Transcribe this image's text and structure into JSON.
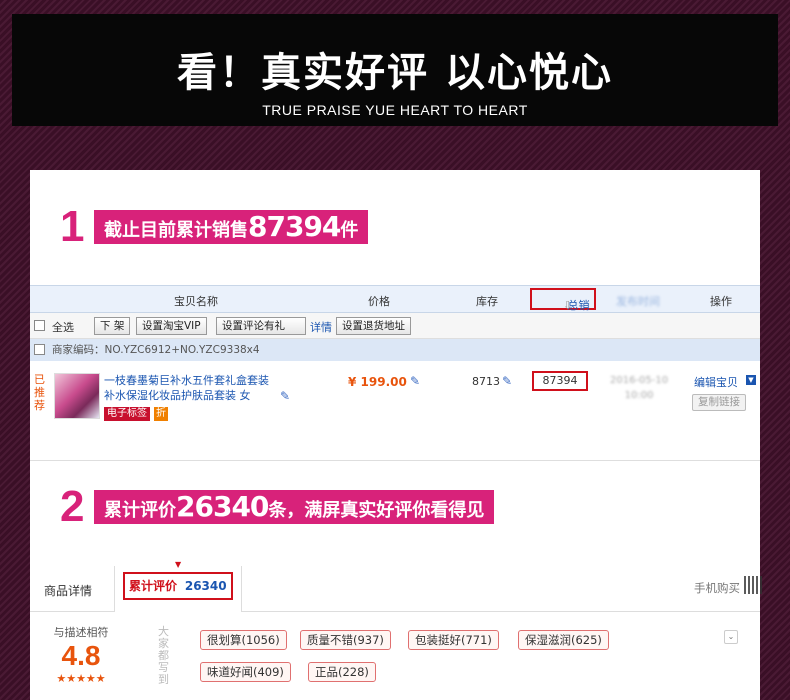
{
  "banner": {
    "title": "看！真实好评 以心悦心",
    "subtitle": "TRUE PRAISE YUE HEART TO HEART"
  },
  "step1": {
    "number": "1",
    "prefix": "截止目前累计销售",
    "value": "87394",
    "suffix": "件"
  },
  "grid": {
    "columns": [
      "宝贝名称",
      "价格",
      "库存",
      "总销量",
      "发布时间",
      "操作"
    ],
    "sort_arrow": "⇩"
  },
  "toolbar": {
    "select_all": "全选",
    "btn_delist": "下 架",
    "btn_vip": "设置淘宝VIP",
    "btn_review_gift": "设置评论有礼",
    "link_detail": "详情",
    "btn_return_addr": "设置退货地址"
  },
  "merchant": {
    "code": "商家编码：NO.YZC6912+NO.YZC9338x4"
  },
  "item": {
    "recommend": [
      "已",
      "推",
      "荐"
    ],
    "title": "一枝春墨菊巨补水五件套礼盒套装 补水保湿化妆品护肤品套装 女",
    "badge_etag": "电子标签",
    "badge_discount": "折",
    "price": "¥ 199.00",
    "stock": "8713",
    "sales": "87394",
    "date": "2016-05-10",
    "time": "10:00",
    "edit": "编辑宝贝",
    "copy": "复制链接"
  },
  "step2": {
    "number": "2",
    "prefix": "累计评价",
    "value": "26340",
    "suffix": "条，满屏真实好评你看得见"
  },
  "tabs": {
    "details": "商品详情",
    "reviews_label": "累计评价",
    "reviews_count": "26340",
    "mobile": "手机购买"
  },
  "rating": {
    "label": "与描述相符",
    "score": "4.8",
    "stars": "★★★★★",
    "everyone_says": "大家都写到"
  },
  "tags": [
    "很划算(1056)",
    "质量不错(937)",
    "包装挺好(771)",
    "保湿滋润(625)",
    "味道好闻(409)",
    "正品(228)"
  ],
  "colors": {
    "accent": "#d8227a",
    "highlight_border": "#d0101b",
    "link_blue": "#1a55b0",
    "price_orange": "#e8540d"
  }
}
